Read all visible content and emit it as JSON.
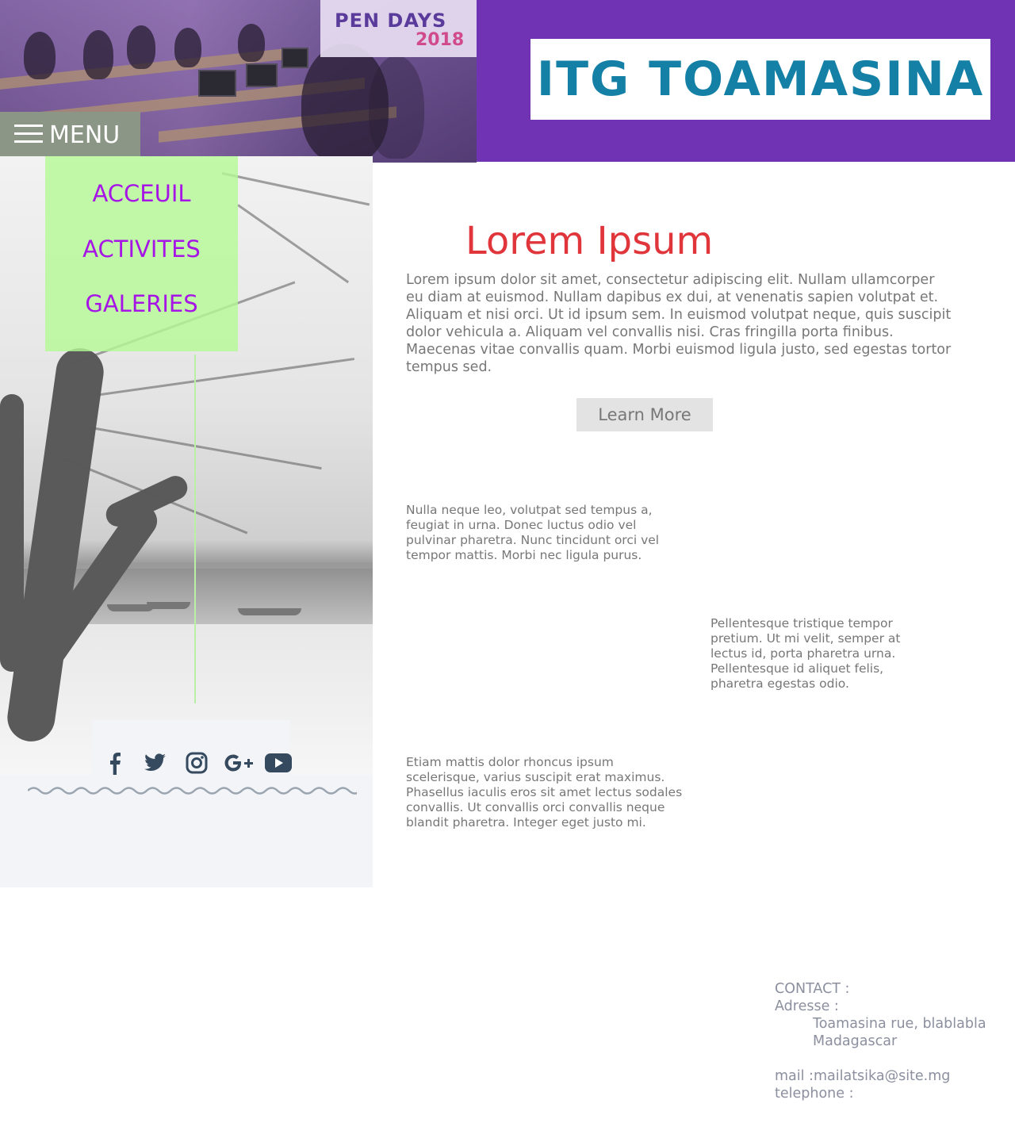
{
  "header": {
    "site_title": "ITG TOAMASINA",
    "hero_banner_text": "PEN DAYS",
    "hero_banner_year": "2018",
    "menu_label": "MENU"
  },
  "nav": {
    "items": [
      "ACCEUIL",
      "ACTIVITES",
      "GALERIES"
    ]
  },
  "social": {
    "icons": [
      "facebook-icon",
      "twitter-icon",
      "instagram-icon",
      "google-plus-icon",
      "youtube-icon"
    ]
  },
  "main": {
    "title": "Lorem Ipsum",
    "intro": "Lorem ipsum dolor sit amet, consectetur adipiscing elit. Nullam ullamcorper eu diam at euismod. Nullam dapibus ex dui, at venenatis sapien volutpat et. Aliquam et nisi orci. Ut id ipsum sem. In euismod volutpat neque, quis suscipit dolor vehicula a. Aliquam vel convallis nisi. Cras fringilla porta finibus. Maecenas vitae convallis quam. Morbi euismod ligula justo, sed egestas tortor tempus sed.",
    "learn_more": "Learn More",
    "paragraph_1": "Nulla neque leo, volutpat sed tempus a, feugiat in urna. Donec luctus odio vel pulvinar pharetra. Nunc tincidunt orci vel tempor mattis. Morbi nec ligula purus.",
    "paragraph_2": "Pellentesque tristique tempor pretium. Ut mi velit, semper at lectus id, porta pharetra urna. Pellentesque id aliquet felis, pharetra egestas odio.",
    "paragraph_3": "Etiam mattis dolor rhoncus ipsum scelerisque, varius suscipit erat maximus. Phasellus iaculis eros sit amet lectus sodales convallis. Ut convallis orci convallis neque blandit pharetra. Integer eget justo mi."
  },
  "contact": {
    "heading": "CONTACT :",
    "address_label": "Adresse :",
    "address_line1": "Toamasina rue, blablabla",
    "address_line2": "Madagascar",
    "mail_label": "mail :",
    "mail_value": "mailatsika@site.mg",
    "phone_label": "telephone :"
  },
  "colors": {
    "header_bg": "#7033b3",
    "title_text": "#1480a6",
    "nav_text": "#a614e6",
    "nav_bg": "#b4fa96",
    "heading_red": "#e0353b",
    "menu_bg": "#8c9686"
  }
}
